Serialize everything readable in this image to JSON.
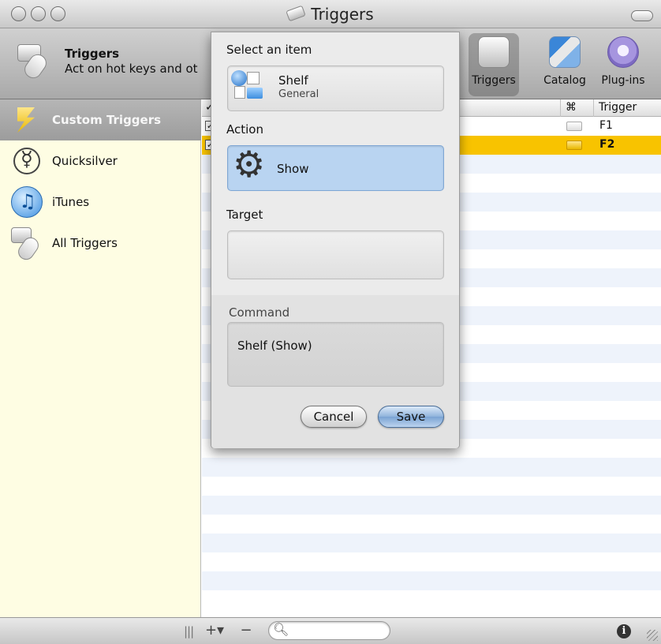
{
  "window": {
    "title": "Triggers"
  },
  "toolbar": {
    "app_title": "Triggers",
    "app_subtitle": "Act on hot keys and ot",
    "buttons": [
      {
        "label": "Triggers",
        "icon": "triggers-icon",
        "active": true
      },
      {
        "label": "Catalog",
        "icon": "catalog-icon",
        "active": false
      },
      {
        "label": "Plug-ins",
        "icon": "plugins-icon",
        "active": false
      }
    ]
  },
  "sidebar": {
    "items": [
      {
        "label": "Custom Triggers",
        "icon": "lightning-bolt-icon",
        "selected": true
      },
      {
        "label": "Quicksilver",
        "icon": "quicksilver-icon",
        "selected": false
      },
      {
        "label": "iTunes",
        "icon": "itunes-icon",
        "selected": false
      },
      {
        "label": "All Triggers",
        "icon": "triggers-icon",
        "selected": false
      }
    ]
  },
  "table": {
    "columns": {
      "check": "✓",
      "command_key": "⌘",
      "trigger": "Trigger"
    },
    "rows": [
      {
        "checked": true,
        "trigger": "F1",
        "selected": false
      },
      {
        "checked": true,
        "trigger": "F2",
        "selected": true
      }
    ],
    "selection_color": "#f8c300"
  },
  "sheet": {
    "select_item_label": "Select an item",
    "item": {
      "name": "Shelf",
      "subtitle": "General",
      "icon": "shelf-icon"
    },
    "action_label": "Action",
    "action": {
      "name": "Show",
      "icon": "gear-icon"
    },
    "target_label": "Target",
    "target_value": "",
    "command_label": "Command",
    "command_value": "Shelf (Show)",
    "cancel_label": "Cancel",
    "save_label": "Save",
    "accent": "#b9d4f1"
  },
  "bottombar": {
    "grip": "|||",
    "add_label": "+▾",
    "remove_label": "−",
    "search_placeholder": "",
    "search_icon": "search-icon",
    "info_label": "i"
  }
}
